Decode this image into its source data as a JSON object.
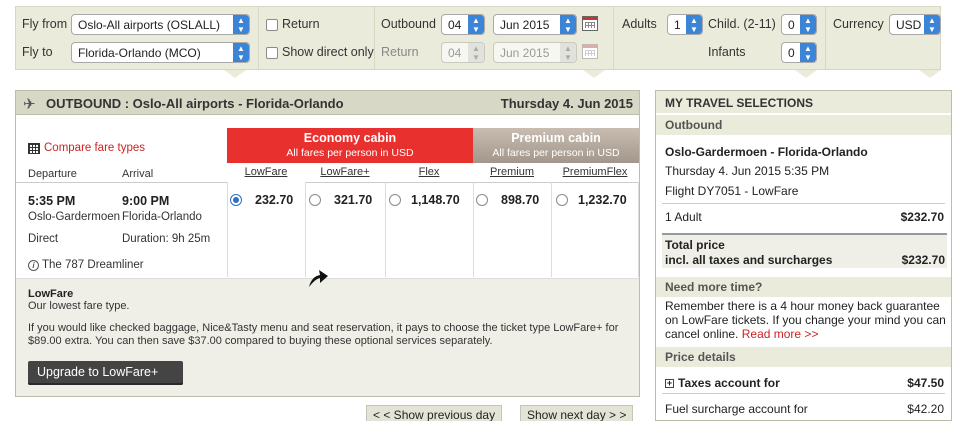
{
  "search": {
    "fly_from_label": "Fly from",
    "fly_from_value": "Oslo-All airports (OSLALL)",
    "fly_to_label": "Fly to",
    "fly_to_value": "Florida-Orlando (MCO)",
    "return_label": "Return",
    "direct_only_label": "Show direct only",
    "outbound_label": "Outbound",
    "outbound_day": "04",
    "outbound_month": "Jun 2015",
    "return_date_label": "Return",
    "return_day": "04",
    "return_month": "Jun 2015",
    "adults_label": "Adults",
    "adults_value": "1",
    "child_label": "Child. (2-11)",
    "child_value": "0",
    "infants_label": "Infants",
    "infants_value": "0",
    "currency_label": "Currency",
    "currency_value": "USD"
  },
  "outbound": {
    "title": "OUTBOUND :  Oslo-All airports - Florida-Orlando",
    "date": "Thursday 4. Jun 2015",
    "compare_link": "Compare fare types",
    "departure_header": "Departure",
    "arrival_header": "Arrival",
    "flight": {
      "dep_time": "5:35 PM",
      "arr_time": "9:00 PM",
      "dep_airport": "Oslo-Gardermoen",
      "arr_airport": "Florida-Orlando",
      "stops": "Direct",
      "duration": "Duration: 9h 25m",
      "aircraft": "The 787 Dreamliner"
    },
    "economy_title": "Economy cabin",
    "economy_sub": "All fares per person in USD",
    "premium_title": "Premium cabin",
    "premium_sub": "All fares per person in USD",
    "fares": [
      {
        "name": "LowFare",
        "price": "232.70",
        "selected": true
      },
      {
        "name": "LowFare+",
        "price": "321.70",
        "selected": false
      },
      {
        "name": "Flex",
        "price": "1,148.70",
        "selected": false
      },
      {
        "name": "Premium",
        "price": "898.70",
        "selected": false
      },
      {
        "name": "PremiumFlex",
        "price": "1,232.70",
        "selected": false
      }
    ],
    "fare_desc_title": "LowFare",
    "fare_desc_sub": "Our lowest fare type.",
    "fare_desc_text": "If you would like checked baggage, Nice&Tasty menu and seat reservation, it pays to choose the ticket type LowFare+ for $89.00 extra. You can then save $37.00 compared to buying these optional services separately.",
    "upgrade_button": "Upgrade to LowFare+",
    "prev_day": "< < Show previous day",
    "next_day": "Show next day > >"
  },
  "selections": {
    "title": "MY TRAVEL SELECTIONS",
    "outbound_label": "Outbound",
    "route": "Oslo-Gardermoen - Florida-Orlando",
    "datetime": "Thursday 4. Jun 2015 5:35 PM",
    "flight": "Flight DY7051 - LowFare",
    "pax": "1 Adult",
    "pax_price": "$232.70",
    "total_label_1": "Total price",
    "total_label_2": "incl. all taxes and surcharges",
    "total_price": "$232.70",
    "more_time_label": "Need more time?",
    "more_time_text": "Remember there is a 4 hour money back guarantee on LowFare tickets. If you change your mind you can cancel online.",
    "read_more": "Read more >>",
    "price_details_label": "Price details",
    "taxes_label": "Taxes account for",
    "taxes_value": "$47.50",
    "fuel_label": "Fuel surcharge account for",
    "fuel_value": "$42.20"
  },
  "colors": {
    "economy": "#e8312f",
    "accent_link": "#cc2222",
    "select_arrow": "#3b84d6"
  }
}
